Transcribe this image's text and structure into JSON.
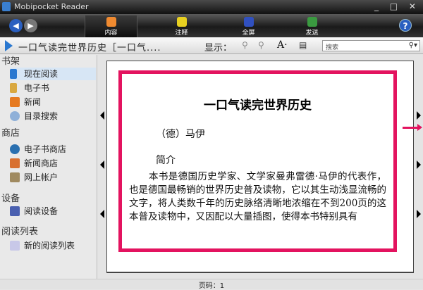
{
  "window": {
    "title": "Mobipocket Reader"
  },
  "toolbar": {
    "tabs": [
      {
        "label": "内容"
      },
      {
        "label": "注释"
      },
      {
        "label": "全屏"
      },
      {
        "label": "发送"
      }
    ],
    "help": "?"
  },
  "bar": {
    "doc_title": "一口气读完世界历史［一口气....",
    "display_label": "显示：",
    "search_placeholder": "搜索"
  },
  "sidebar": {
    "sections": [
      {
        "title": "书架",
        "items": [
          "现在阅读",
          "电子书",
          "新闻",
          "目录搜索"
        ]
      },
      {
        "title": "商店",
        "items": [
          "电子书商店",
          "新闻商店",
          "网上帐户"
        ]
      },
      {
        "title": "设备",
        "items": [
          "阅读设备"
        ]
      },
      {
        "title": "阅读列表",
        "items": [
          "新的阅读列表"
        ]
      }
    ]
  },
  "page": {
    "title": "一口气读完世界历史",
    "author": "（德）马伊",
    "intro": "简介",
    "body": "本书是德国历史学家、文学家曼弗雷德·马伊的代表作，也是德国最畅销的世界历史普及读物，它以其生动浅显流畅的文字，将人类数千年的历史脉络清晰地浓缩在不到200页的这本普及读物中，又因配以大量插图，使得本书特别具有"
  },
  "status": {
    "page": "页码：1"
  },
  "colors": {
    "highlight": "#e3135f",
    "accent": "#2a78d0"
  }
}
